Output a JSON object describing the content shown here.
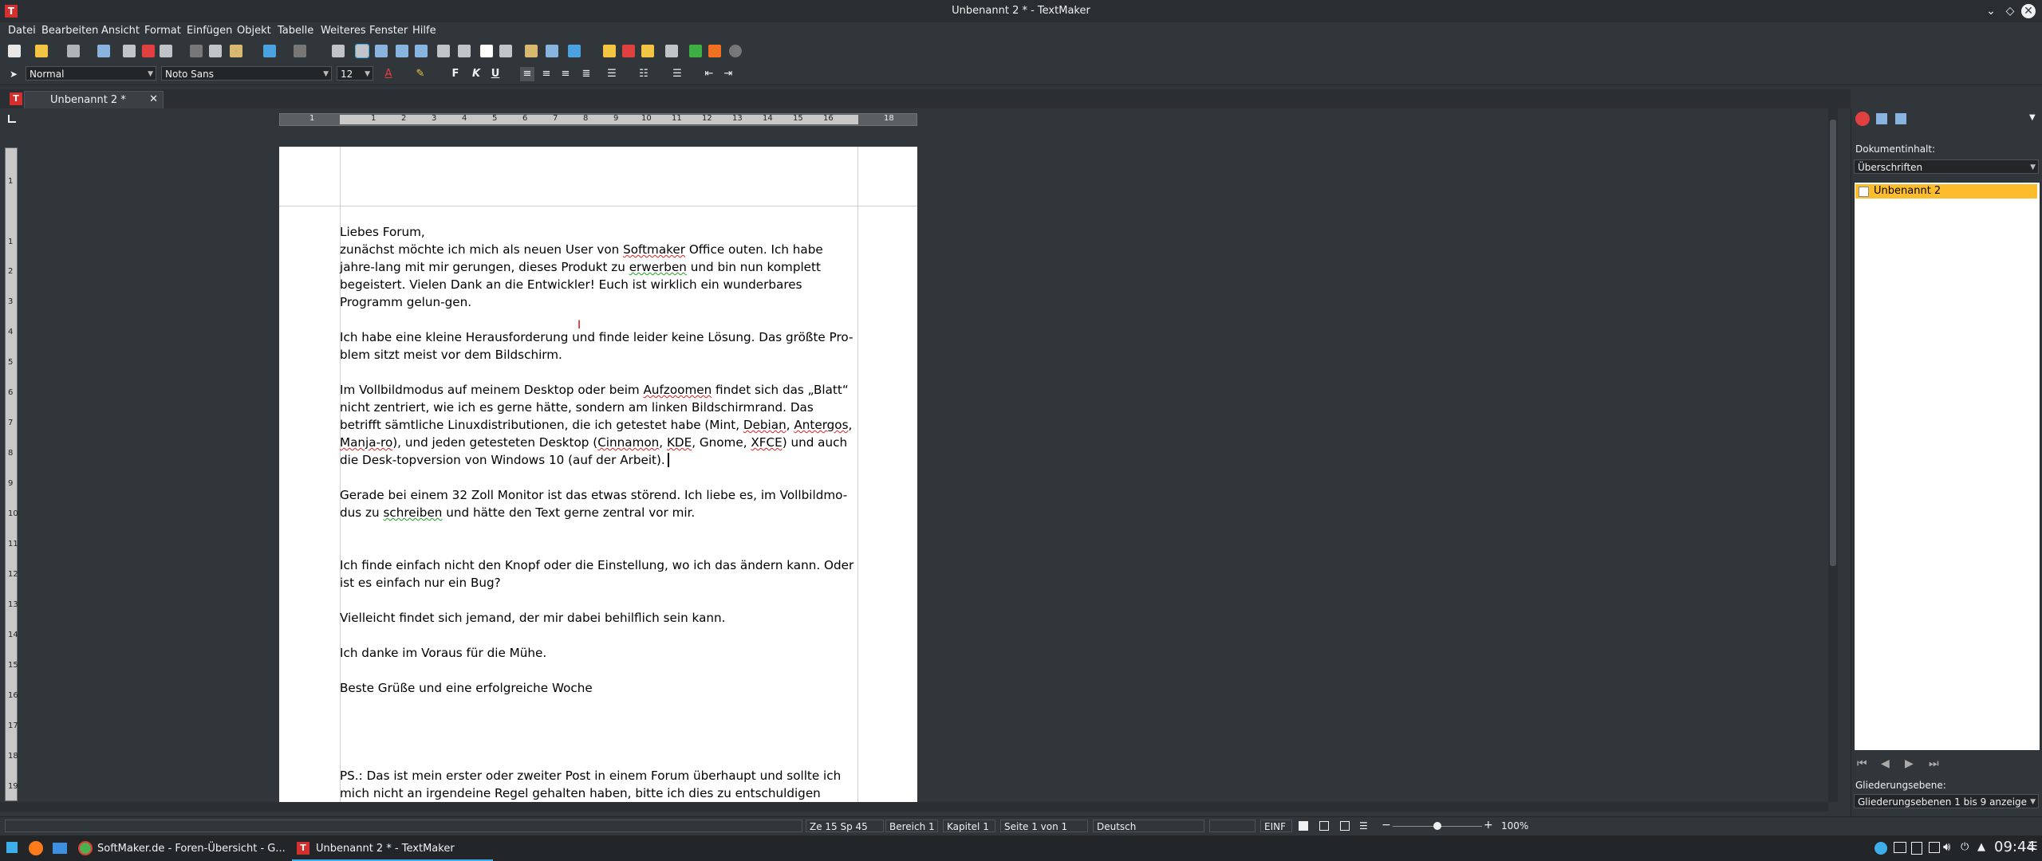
{
  "window": {
    "title": "Unbenannt 2 * - TextMaker",
    "app_logo": "T"
  },
  "menu": [
    "Datei",
    "Bearbeiten",
    "Ansicht",
    "Format",
    "Einfügen",
    "Objekt",
    "Tabelle",
    "Weiteres",
    "Fenster",
    "Hilfe"
  ],
  "format_bar": {
    "style": "Normal",
    "font": "Noto Sans",
    "size": "12",
    "bold": "F",
    "italic": "K",
    "underline": "U"
  },
  "tab": {
    "label": "Unbenannt 2 *"
  },
  "ruler": {
    "numbers": [
      "1",
      "1",
      "2",
      "3",
      "4",
      "5",
      "6",
      "7",
      "8",
      "9",
      "10",
      "11",
      "12",
      "13",
      "14",
      "15",
      "16",
      "18"
    ],
    "vnumbers": [
      "1",
      "1",
      "2",
      "3",
      "4",
      "5",
      "6",
      "7",
      "8",
      "9",
      "10",
      "11",
      "12",
      "13",
      "14",
      "15",
      "16",
      "17",
      "18",
      "19"
    ]
  },
  "document": {
    "p1a": "Liebes Forum,",
    "p1b_1": "zunächst möchte ich mich als neuen User von ",
    "p1b_sm": "Softmaker",
    "p1b_2": " Office outen. Ich habe jahre-lang mit mir gerungen, dieses Produkt zu ",
    "p1b_er": "erwerben",
    "p1b_3": " und bin nun komplett begeistert. Vielen Dank an die Entwickler! Euch ist wirklich ein wunderbares Programm gelun-gen.",
    "p2": "Ich habe eine kleine Herausforderung und finde leider keine Lösung. Das größte Pro-blem sitzt meist vor dem Bildschirm.",
    "p3_1": "Im Vollbildmodus auf meinem Desktop oder beim ",
    "p3_az": "Aufzoomen",
    "p3_2": " findet sich das „Blatt“ nicht zentriert, wie ich es gerne hätte, sondern am linken Bildschirmrand. Das betrifft sämtliche Linuxdistributionen, die ich getestet habe (Mint, ",
    "p3_deb": "Debian",
    "p3_3": ", ",
    "p3_ant": "Antergos",
    "p3_4": ", ",
    "p3_man": "Manja-ro",
    "p3_5": "), und jeden getesteten Desktop (",
    "p3_cin": "Cinnamon",
    "p3_6": ", ",
    "p3_kde": "KDE",
    "p3_7": ", Gnome, ",
    "p3_xf": "XFCE",
    "p3_8": ") und auch die Desk-topversion von Windows 10 (auf der Arbeit).",
    "p4_1": "Gerade bei einem 32 Zoll Monitor ist das etwas störend. Ich liebe es, im Vollbildmo-dus zu ",
    "p4_sch": "schreiben",
    "p4_2": " und hätte den Text gerne zentral vor mir.",
    "p5": "Ich finde einfach nicht den Knopf oder die Einstellung, wo ich das ändern kann. Oder ist es einfach nur ein Bug?",
    "p6": "Vielleicht findet sich jemand, der mir dabei behilflich sein kann.",
    "p7": "Ich danke im Voraus für die Mühe.",
    "p8": "Beste Grüße und eine erfolgreiche Woche",
    "p9": "PS.: Das ist mein erster oder zweiter Post in einem Forum überhaupt und sollte ich mich nicht an irgendeine Regel gehalten haben, bitte ich dies zu entschuldigen"
  },
  "sidebar": {
    "label": "Dokumentinhalt:",
    "select": "Überschriften",
    "item": "Unbenannt 2",
    "level_label": "Gliederungsebene:",
    "level_select": "Gliederungsebenen 1 bis 9 anzeige"
  },
  "status": {
    "pos": "Ze 15 Sp 45",
    "bereich": "Bereich 1",
    "kapitel": "Kapitel 1",
    "seite": "Seite 1 von 1",
    "lang": "Deutsch",
    "mode": "EINF",
    "zoom": "100%"
  },
  "zoom_level": 0.5,
  "taskbar": {
    "item1": "SoftMaker.de - Foren-Übersicht - G...",
    "item2": "Unbenannt 2 * - TextMaker",
    "clock": "09:44"
  },
  "colors": {
    "accent": "#3daee9",
    "highlight": "#fdbc2c",
    "app_red": "#d32f2f"
  }
}
